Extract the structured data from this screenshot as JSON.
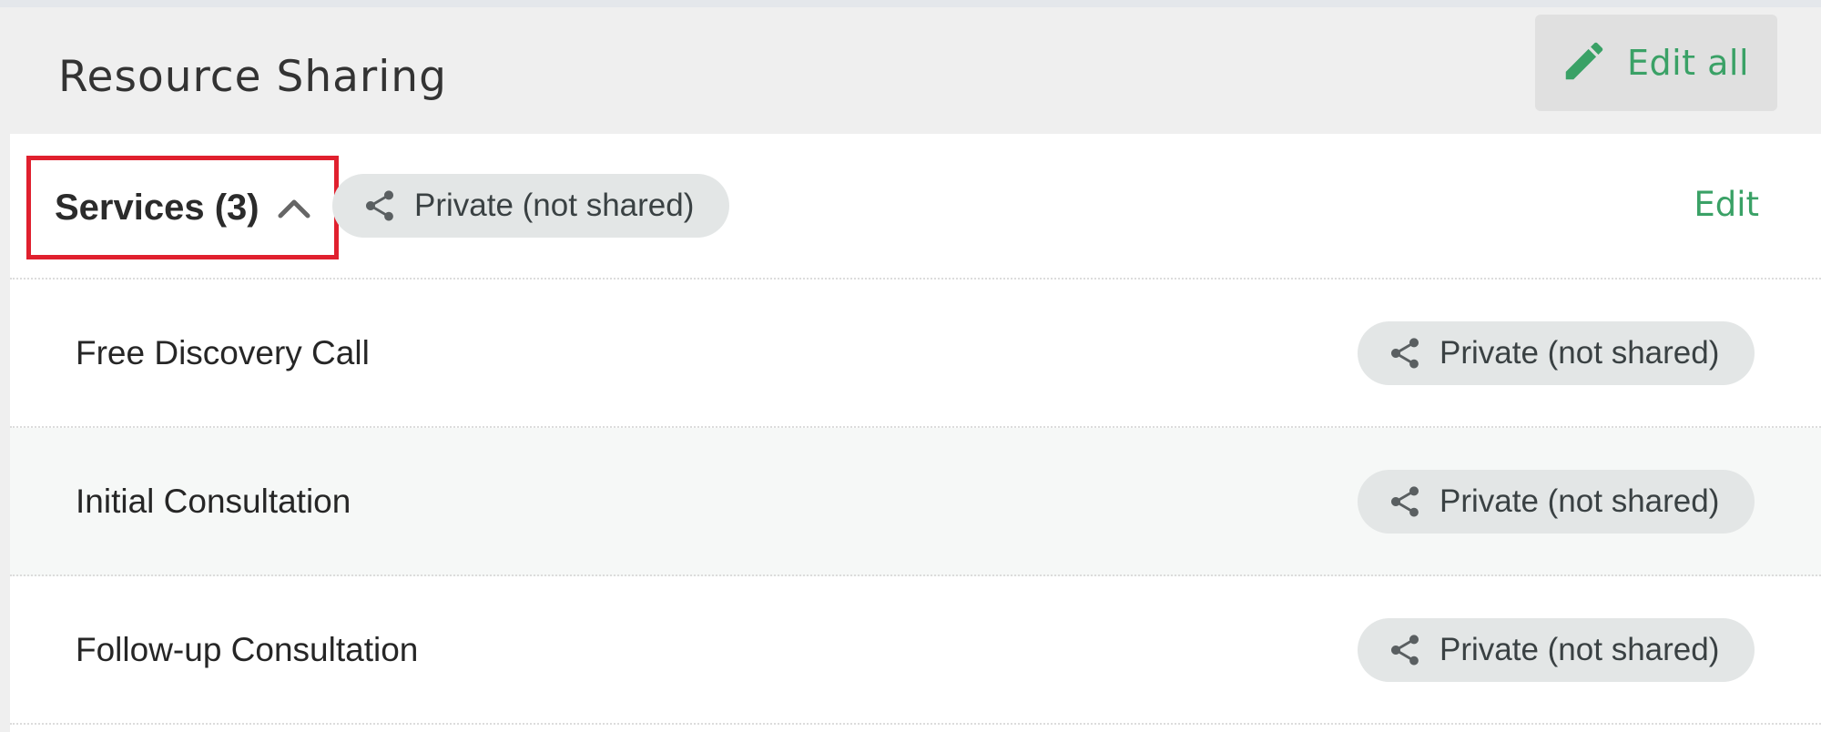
{
  "header": {
    "title": "Resource Sharing",
    "edit_all_label": "Edit all",
    "edit_all_icon": "pencil-icon"
  },
  "section": {
    "title": "Services (3)",
    "toggle_icon": "chevron-up-icon",
    "sharing_label": "Private (not shared)",
    "sharing_icon": "share-icon",
    "edit_label": "Edit"
  },
  "items": [
    {
      "name": "Free Discovery Call",
      "sharing_label": "Private (not shared)"
    },
    {
      "name": "Initial Consultation",
      "sharing_label": "Private (not shared)"
    },
    {
      "name": "Follow-up Consultation",
      "sharing_label": "Private (not shared)"
    }
  ],
  "colors": {
    "accent_green": "#3aa166",
    "highlight_red": "#e0202e",
    "pill_background": "#e3e6e6"
  }
}
